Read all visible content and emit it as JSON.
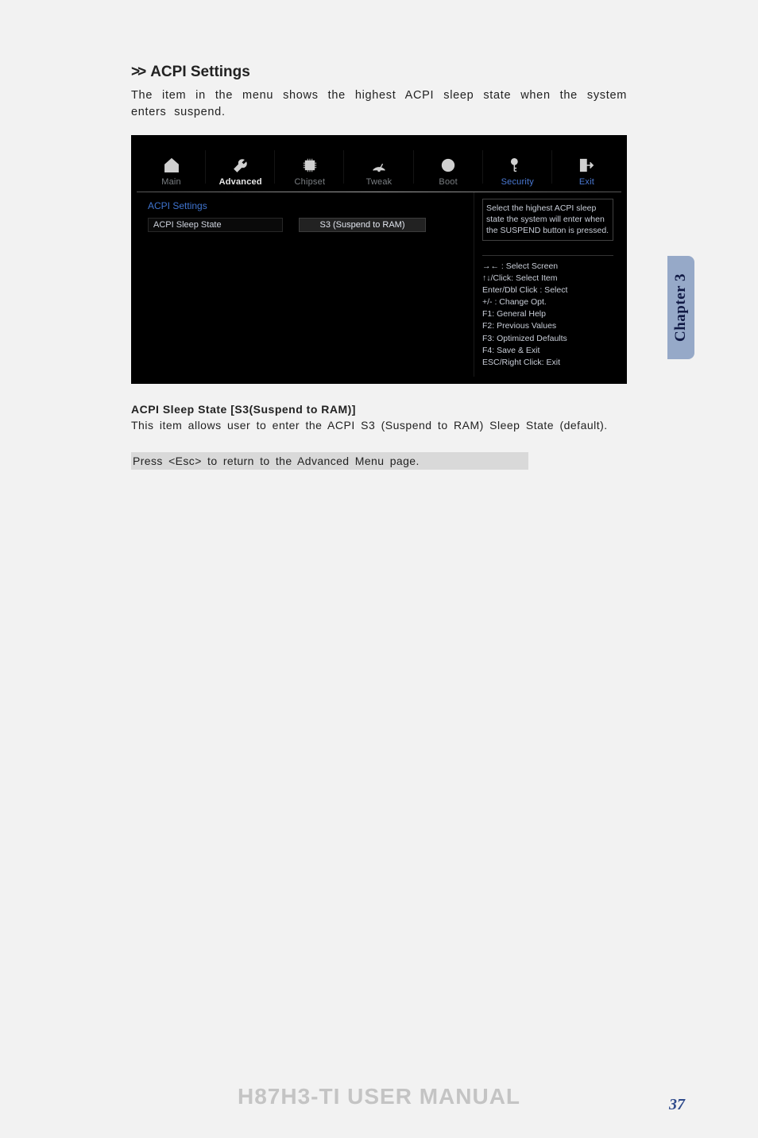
{
  "heading": {
    "marker": ">>",
    "title": "ACPI Settings",
    "desc": "The item in the menu shows the highest ACPI sleep state when the system enters suspend."
  },
  "bios": {
    "tabs": [
      {
        "label": "Main",
        "active": false
      },
      {
        "label": "Advanced",
        "active": true
      },
      {
        "label": "Chipset",
        "active": false
      },
      {
        "label": "Tweak",
        "active": false
      },
      {
        "label": "Boot",
        "active": false
      },
      {
        "label": "Security",
        "active": false,
        "blue": true
      },
      {
        "label": "Exit",
        "active": false,
        "blue": true
      }
    ],
    "left": {
      "group_title": "ACPI Settings",
      "option_label": "ACPI Sleep State",
      "option_value": "S3 (Suspend to RAM)"
    },
    "right": {
      "help_text": "Select the highest ACPI sleep state the system will enter when the SUSPEND button is pressed.",
      "keys": [
        "→←   : Select Screen",
        "↑↓/Click: Select Item",
        "Enter/Dbl Click : Select",
        "+/- : Change Opt.",
        "F1: General Help",
        "F2: Previous Values",
        "F3: Optimized Defaults",
        "F4: Save & Exit",
        "ESC/Right Click: Exit"
      ]
    }
  },
  "item": {
    "heading": "ACPI Sleep State [S3(Suspend to RAM)]",
    "desc": "This item allows user to enter the ACPI S3 (Suspend to RAM) Sleep State (default)."
  },
  "esc_note": "Press <Esc> to return to the Advanced Menu page.",
  "side_tab": "Chapter 3",
  "footer": {
    "title": "H87H3-TI USER MANUAL",
    "page": "37"
  }
}
